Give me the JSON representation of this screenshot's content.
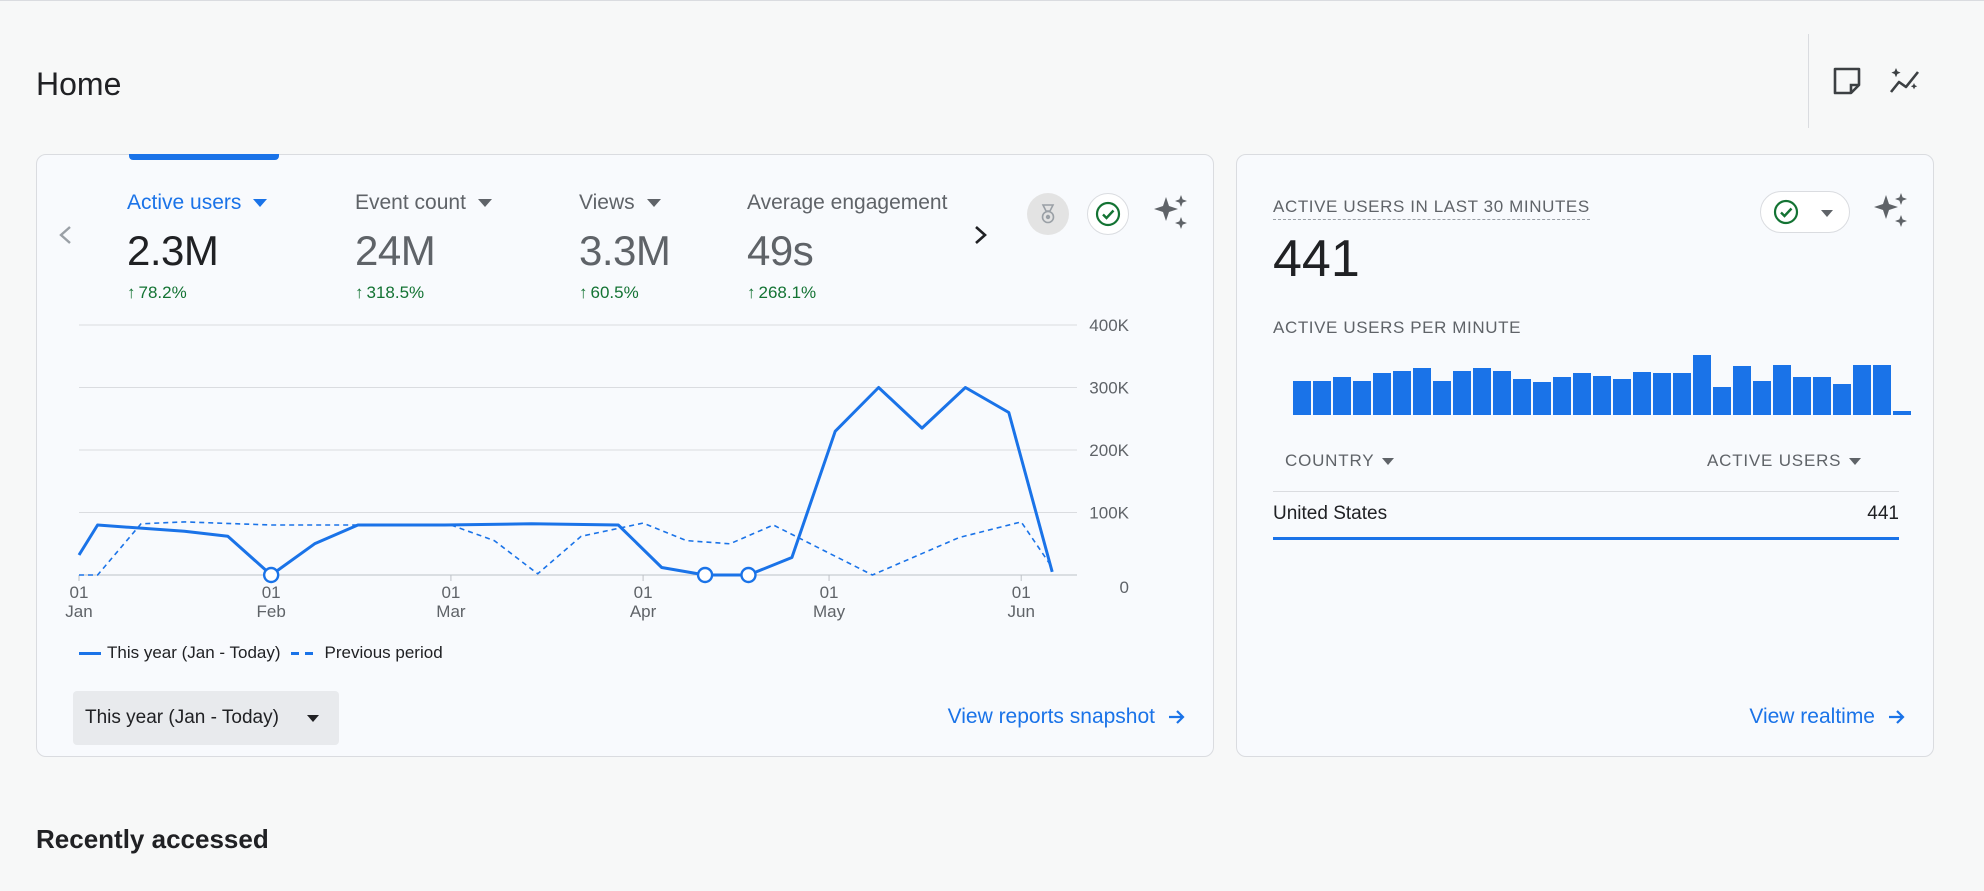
{
  "page": {
    "title": "Home",
    "section_recent": "Recently accessed"
  },
  "header": {
    "icons": [
      "notes-icon",
      "insights-icon"
    ]
  },
  "metrics": [
    {
      "label": "Active users",
      "value": "2.3M",
      "delta": "78.2%",
      "active": true
    },
    {
      "label": "Event count",
      "value": "24M",
      "delta": "318.5%",
      "active": false
    },
    {
      "label": "Views",
      "value": "3.3M",
      "delta": "60.5%",
      "active": false
    },
    {
      "label": "Average engagement",
      "value": "49s",
      "delta": "268.1%",
      "active": false
    }
  ],
  "chart_data": {
    "type": "line",
    "x_ticks": [
      {
        "day": "01",
        "month": "Jan"
      },
      {
        "day": "01",
        "month": "Feb"
      },
      {
        "day": "01",
        "month": "Mar"
      },
      {
        "day": "01",
        "month": "Apr"
      },
      {
        "day": "01",
        "month": "May"
      },
      {
        "day": "01",
        "month": "Jun"
      }
    ],
    "y_ticks": [
      "400K",
      "300K",
      "200K",
      "100K",
      "0"
    ],
    "ylim": [
      0,
      400000
    ],
    "grid": true,
    "legend_position": "bottom-left",
    "series": [
      {
        "name": "This year (Jan - Today)",
        "style": "solid",
        "x": [
          "2024-01-01",
          "2024-01-04",
          "2024-01-18",
          "2024-01-25",
          "2024-02-01",
          "2024-02-08",
          "2024-02-15",
          "2024-02-29",
          "2024-03-14",
          "2024-03-28",
          "2024-04-04",
          "2024-04-11",
          "2024-04-18",
          "2024-04-25",
          "2024-05-02",
          "2024-05-09",
          "2024-05-16",
          "2024-05-23",
          "2024-05-30",
          "2024-06-06"
        ],
        "values": [
          32000,
          80000,
          70000,
          62000,
          0,
          50000,
          80000,
          80000,
          82000,
          80000,
          12000,
          0,
          0,
          28000,
          230000,
          300000,
          235000,
          300000,
          260000,
          5000
        ],
        "markers": [
          "2024-02-01",
          "2024-04-11",
          "2024-04-18"
        ]
      },
      {
        "name": "Previous period",
        "style": "dashed",
        "x": [
          "2024-01-01",
          "2024-01-04",
          "2024-01-11",
          "2024-01-18",
          "2024-02-01",
          "2024-02-15",
          "2024-03-01",
          "2024-03-08",
          "2024-03-15",
          "2024-03-22",
          "2024-04-01",
          "2024-04-08",
          "2024-04-15",
          "2024-04-22",
          "2024-05-08",
          "2024-05-22",
          "2024-06-01",
          "2024-06-06"
        ],
        "values": [
          0,
          0,
          82000,
          85000,
          80000,
          80000,
          80000,
          55000,
          2000,
          62000,
          83000,
          55000,
          50000,
          80000,
          0,
          60000,
          85000,
          12000
        ]
      }
    ]
  },
  "date_range": {
    "label": "This year (Jan - Today)"
  },
  "links": {
    "snapshot": "View reports snapshot",
    "realtime": "View realtime"
  },
  "realtime": {
    "title": "ACTIVE USERS IN LAST 30 MINUTES",
    "value": "441",
    "per_minute_label": "ACTIVE USERS PER MINUTE",
    "per_minute_values": [
      0.56,
      0.56,
      0.63,
      0.56,
      0.7,
      0.74,
      0.78,
      0.57,
      0.74,
      0.78,
      0.73,
      0.6,
      0.55,
      0.63,
      0.7,
      0.65,
      0.6,
      0.72,
      0.7,
      0.7,
      1.0,
      0.47,
      0.82,
      0.56,
      0.83,
      0.63,
      0.63,
      0.52,
      0.83,
      0.83,
      0.06
    ],
    "table": {
      "col_country": "COUNTRY",
      "col_users": "ACTIVE USERS",
      "rows": [
        {
          "country": "United States",
          "users": "441"
        }
      ]
    }
  },
  "colors": {
    "accent": "#1a73e8",
    "positive": "#137333",
    "text": "#202124",
    "muted": "#5f6368"
  }
}
